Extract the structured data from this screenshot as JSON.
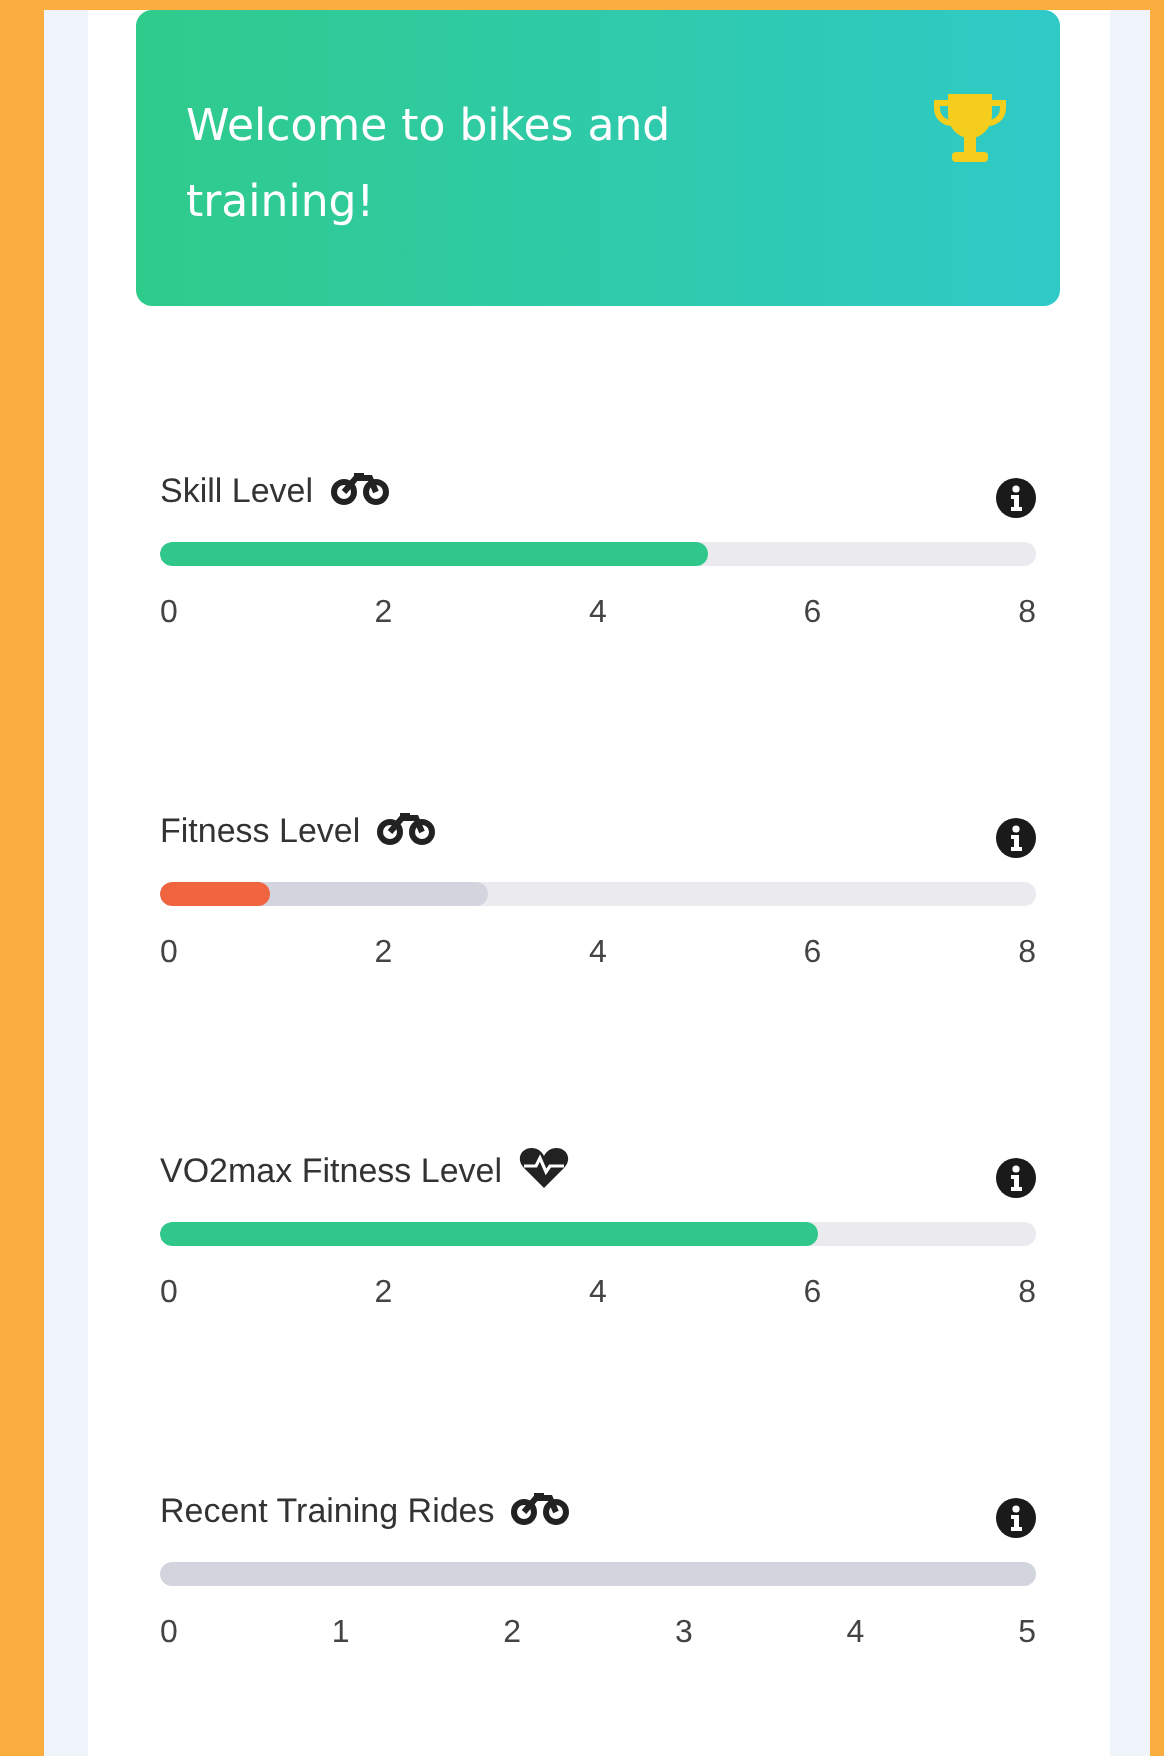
{
  "banner": {
    "title": "Welcome to bikes and training!"
  },
  "meters": [
    {
      "label": "Skill Level",
      "kind": "bike",
      "segments": [
        {
          "level": 0.625,
          "color": "#2fc88a"
        }
      ],
      "ticks": [
        "0",
        "2",
        "4",
        "6",
        "8"
      ]
    },
    {
      "label": "Fitness Level",
      "kind": "bike",
      "segments": [
        {
          "level": 0.375,
          "color": "#d3d5de"
        },
        {
          "level": 0.125,
          "color": "#f06440"
        }
      ],
      "ticks": [
        "0",
        "2",
        "4",
        "6",
        "8"
      ]
    },
    {
      "label": "VO2max Fitness Level",
      "kind": "heart",
      "segments": [
        {
          "level": 0.75,
          "color": "#2fc88a"
        }
      ],
      "ticks": [
        "0",
        "2",
        "4",
        "6",
        "8"
      ]
    },
    {
      "label": "Recent Training Rides",
      "kind": "bike",
      "segments": [
        {
          "level": 1,
          "color": "#d3d5de"
        }
      ],
      "ticks": [
        "0",
        "1",
        "2",
        "3",
        "4",
        "5"
      ]
    }
  ]
}
